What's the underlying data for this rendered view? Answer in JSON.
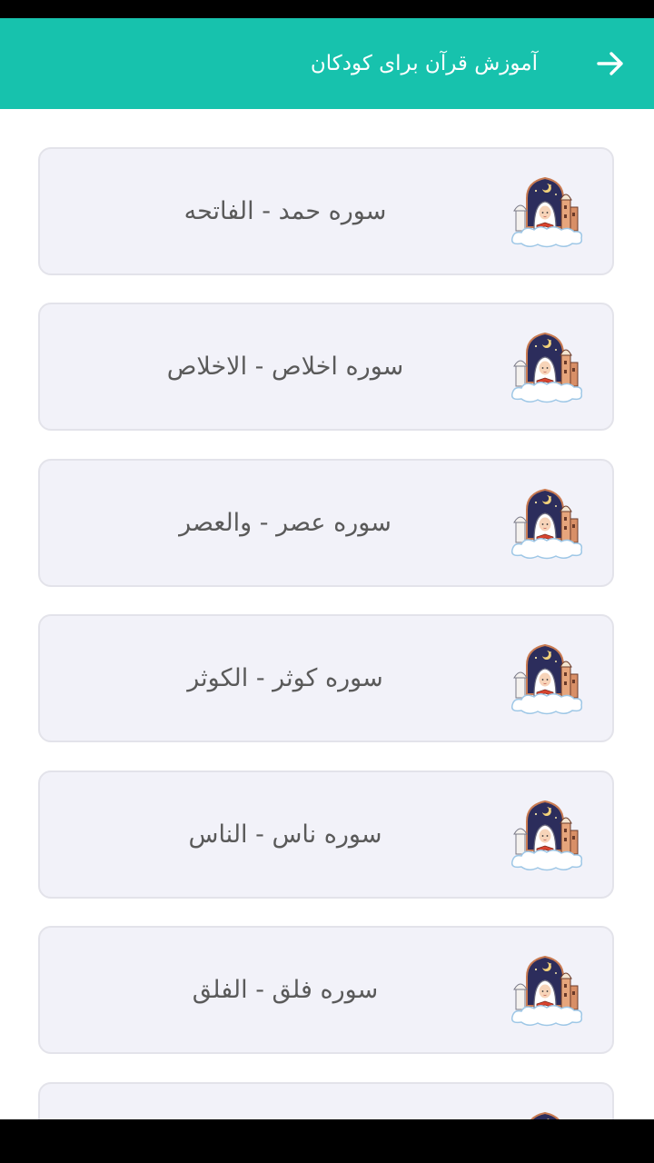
{
  "header": {
    "title": "آموزش قرآن برای کودکان",
    "back_icon": "arrow-right-icon"
  },
  "surahs": [
    {
      "label": "سوره حمد - الفاتحه",
      "icon": "quran-girl-icon"
    },
    {
      "label": "سوره اخلاص - الاخلاص",
      "icon": "quran-girl-icon"
    },
    {
      "label": "سوره عصر - والعصر",
      "icon": "quran-girl-icon"
    },
    {
      "label": "سوره کوثر - الکوثر",
      "icon": "quran-girl-icon"
    },
    {
      "label": "سوره ناس - الناس",
      "icon": "quran-girl-icon"
    },
    {
      "label": "سوره فلق - الفلق",
      "icon": "quran-girl-icon"
    },
    {
      "label": "",
      "icon": "quran-girl-icon"
    }
  ],
  "colors": {
    "app_bar": "#17c2ad",
    "card_bg": "#f2f2f9",
    "card_border": "#e3e3ea",
    "label_text": "#5a5a5a"
  }
}
